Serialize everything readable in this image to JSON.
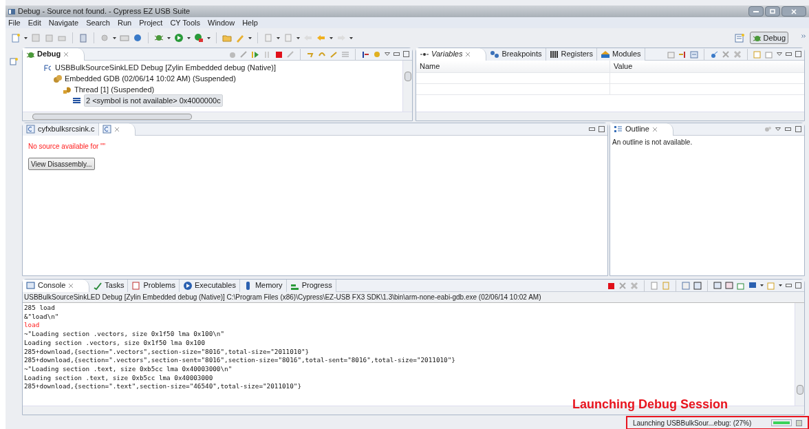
{
  "window": {
    "title": "Debug - Source not found. - Cypress EZ USB Suite"
  },
  "menu": [
    "File",
    "Edit",
    "Navigate",
    "Search",
    "Run",
    "Project",
    "CY Tools",
    "Window",
    "Help"
  ],
  "perspectives": [
    {
      "label": "Debug",
      "selected": true
    }
  ],
  "debug_view": {
    "tab": "Debug",
    "tree": [
      {
        "label": "USBBulkSourceSinkLED Debug [Zylin Embedded debug (Native)]",
        "kind": "launch",
        "children": [
          {
            "label": "Embedded GDB (02/06/14 10:02 AM) (Suspended)",
            "kind": "debugger",
            "children": [
              {
                "label": "Thread [1] (Suspended)",
                "kind": "thread",
                "children": [
                  {
                    "label": "2 <symbol is not available> 0x4000000c",
                    "kind": "frame",
                    "selected": true
                  }
                ]
              }
            ]
          }
        ]
      }
    ]
  },
  "variables_view": {
    "tabs": [
      {
        "label": "Variables",
        "selected": true
      },
      {
        "label": "Breakpoints",
        "selected": false
      },
      {
        "label": "Registers",
        "selected": false
      },
      {
        "label": "Modules",
        "selected": false
      }
    ],
    "columns": [
      "Name",
      "Value"
    ]
  },
  "editor": {
    "tabs": [
      {
        "label": "cyfxbulksrcsink.c",
        "selected": false
      },
      {
        "selected": true
      }
    ],
    "message": "No source available for \"\"",
    "button": "View Disassembly..."
  },
  "outline": {
    "tab": "Outline",
    "message": "An outline is not available."
  },
  "console": {
    "tabs": [
      {
        "label": "Console",
        "selected": true
      },
      {
        "label": "Tasks",
        "selected": false
      },
      {
        "label": "Problems",
        "selected": false
      },
      {
        "label": "Executables",
        "selected": false
      },
      {
        "label": "Memory",
        "selected": false
      },
      {
        "label": "Progress",
        "selected": false
      }
    ],
    "header": "USBBulkSourceSinkLED Debug [Zylin Embedded debug (Native)] C:\\Program Files (x86)\\Cypress\\EZ-USB FX3 SDK\\1.3\\bin\\arm-none-eabi-gdb.exe (02/06/14 10:02 AM)",
    "lines": [
      {
        "text": "285 load",
        "kind": "output"
      },
      {
        "text": "&\"load\\n\"",
        "kind": "output"
      },
      {
        "text": "load",
        "kind": "error"
      },
      {
        "text": "~\"Loading section .vectors, size 0x1f50 lma 0x100\\n\"",
        "kind": "output"
      },
      {
        "text": "Loading section .vectors, size 0x1f50 lma 0x100",
        "kind": "output"
      },
      {
        "text": "285+download,{section=\".vectors\",section-size=\"8016\",total-size=\"2011010\"}",
        "kind": "output"
      },
      {
        "text": "285+download,{section=\".vectors\",section-sent=\"8016\",section-size=\"8016\",total-sent=\"8016\",total-size=\"2011010\"}",
        "kind": "output"
      },
      {
        "text": "~\"Loading section .text, size 0xb5cc lma 0x40003000\\n\"",
        "kind": "output"
      },
      {
        "text": "Loading section .text, size 0xb5cc lma 0x40003000",
        "kind": "output"
      },
      {
        "text": "285+download,{section=\".text\",section-size=\"46540\",total-size=\"2011010\"}",
        "kind": "output"
      }
    ]
  },
  "status_bar": {
    "text": "Launching USBBulkSour...ebug: (27%)",
    "level": 1
  },
  "annotation": "Launching Debug Session"
}
